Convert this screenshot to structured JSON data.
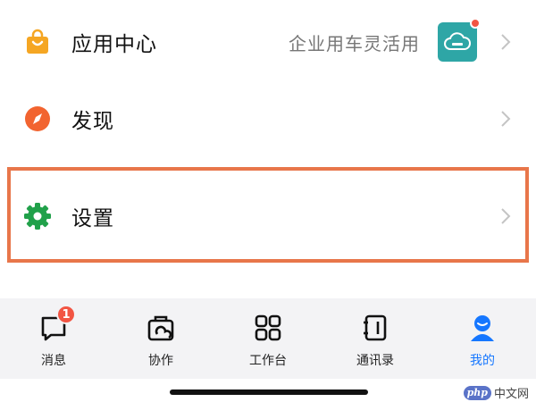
{
  "menu": {
    "app_center": {
      "label": "应用中心",
      "right_text": "企业用车灵活用",
      "icon": "shopping-bag-icon",
      "icon_color": "#f5a623",
      "has_red_dot": true
    },
    "discover": {
      "label": "发现",
      "icon": "compass-icon",
      "icon_color": "#f26430"
    },
    "settings": {
      "label": "设置",
      "icon": "gear-icon",
      "icon_color": "#21a14a"
    }
  },
  "tabbar": {
    "tabs": [
      {
        "label": "消息",
        "icon": "message-icon",
        "badge": "1"
      },
      {
        "label": "协作",
        "icon": "collaboration-icon"
      },
      {
        "label": "工作台",
        "icon": "workbench-grid-icon"
      },
      {
        "label": "通讯录",
        "icon": "contacts-icon"
      },
      {
        "label": "我的",
        "icon": "profile-icon",
        "active": true
      }
    ]
  },
  "colors": {
    "accent": "#1677ff",
    "highlight": "#e8764a",
    "badge": "#f25543"
  },
  "watermark": {
    "logo": "php",
    "text": "中文网"
  }
}
